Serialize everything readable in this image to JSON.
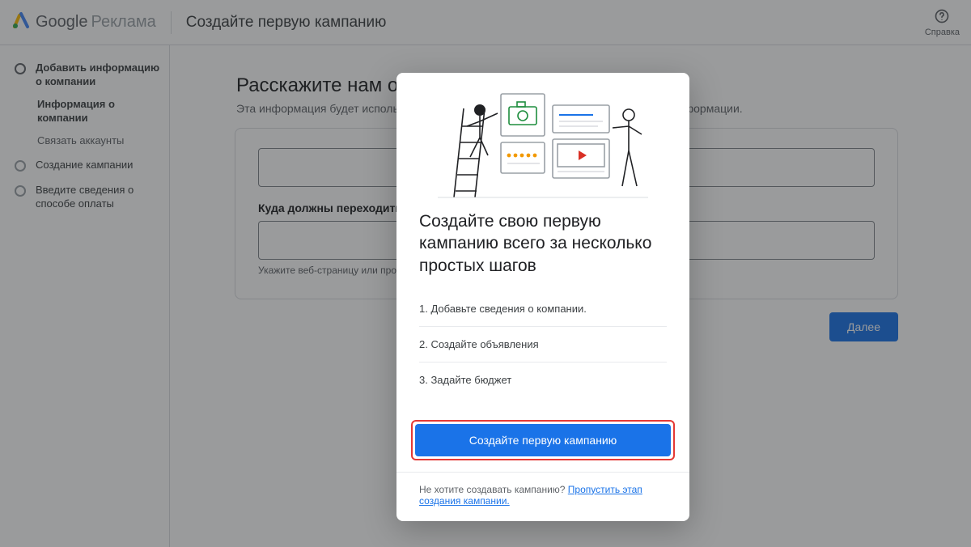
{
  "header": {
    "brand_google": "Google",
    "brand_ads": "Реклама",
    "page_title": "Создайте первую кампанию",
    "help_label": "Справка"
  },
  "sidebar": {
    "step1_label": "Добавить информацию о компании",
    "step1_sub1": "Информация о компании",
    "step1_sub2": "Связать аккаунты",
    "step2_label": "Создание кампании",
    "step3_label": "Введите сведения о способе оплаты"
  },
  "background_page": {
    "heading": "Расскажите нам о своей компании",
    "sub": "Эта информация будет использоваться для создания рекомендаций и рекламной информации.",
    "field2_label": "Куда должны переходить пользователи после того, как нажали на ваше",
    "help_text": "Укажите веб-страницу или профиль компании в социальной сети.",
    "next_button": "Далее"
  },
  "modal": {
    "heading": "Создайте свою первую кампанию всего за несколько простых шагов",
    "step1": "1. Добавьте сведения о компании.",
    "step2": "2. Создайте объявления",
    "step3": "3. Задайте бюджет",
    "cta": "Создайте первую кампанию",
    "footer_text": "Не хотите создавать кампанию? ",
    "footer_link": "Пропустить этап создания кампании."
  }
}
